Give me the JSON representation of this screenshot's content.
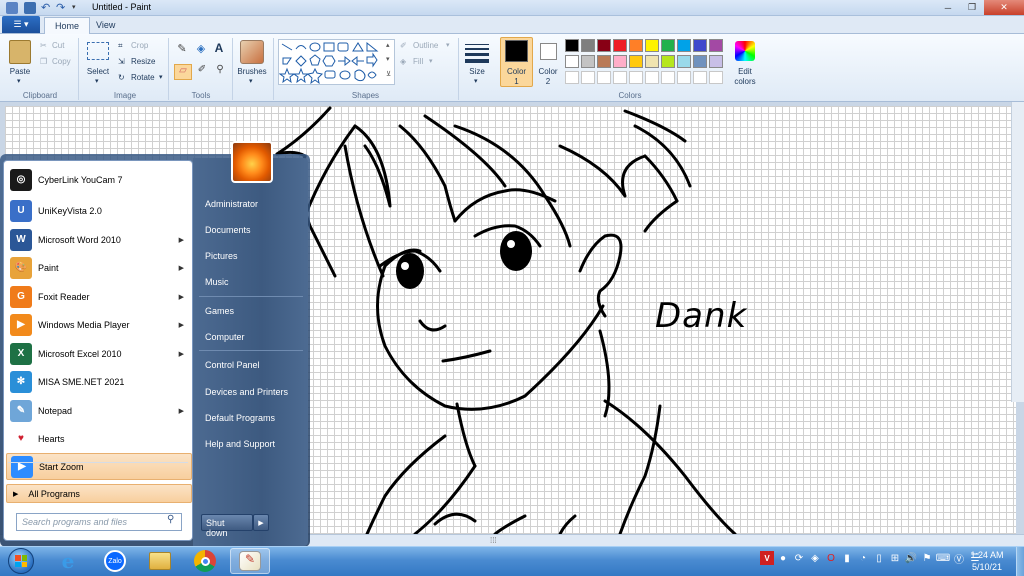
{
  "window": {
    "title": "Untitled - Paint"
  },
  "tabs": {
    "file": "",
    "home": "Home",
    "view": "View"
  },
  "clipboard": {
    "paste": "Paste",
    "cut": "Cut",
    "copy": "Copy",
    "group": "Clipboard"
  },
  "image": {
    "select": "Select",
    "crop": "Crop",
    "resize": "Resize",
    "rotate": "Rotate",
    "group": "Image"
  },
  "tools": {
    "group": "Tools"
  },
  "brushes": {
    "label": "Brushes"
  },
  "shapes": {
    "outline": "Outline",
    "fill": "Fill",
    "group": "Shapes"
  },
  "size": {
    "label": "Size"
  },
  "colors": {
    "color1_line1": "Color",
    "color1_line2": "1",
    "color2_line1": "Color",
    "color2_line2": "2",
    "edit_line1": "Edit",
    "edit_line2": "colors",
    "group": "Colors",
    "palette_row1": [
      "#000000",
      "#7f7f7f",
      "#880015",
      "#ed1c24",
      "#ff7f27",
      "#fff200",
      "#22b14c",
      "#00a2e8",
      "#3f48cc",
      "#a349a4"
    ],
    "palette_row2": [
      "#ffffff",
      "#c3c3c3",
      "#b97a57",
      "#ffaec9",
      "#ffc90e",
      "#efe4b0",
      "#b5e61d",
      "#99d9ea",
      "#7092be",
      "#c8bfe7"
    ],
    "palette_row3": [
      "#ffffff",
      "#ffffff",
      "#ffffff",
      "#ffffff",
      "#ffffff",
      "#ffffff",
      "#ffffff",
      "#ffffff",
      "#ffffff",
      "#ffffff"
    ]
  },
  "canvas": {
    "signature": "Dank"
  },
  "start_menu": {
    "left_items": [
      {
        "label": "CyberLink YouCam 7",
        "icon": "youcam-icon",
        "color": "#1a1a1a",
        "glyph": "◎",
        "arrow": ""
      },
      {
        "label": "UniKeyVista 2.0",
        "icon": "unikey-icon",
        "color": "#3a6fc8",
        "glyph": "U",
        "arrow": ""
      },
      {
        "label": "Microsoft Word 2010",
        "icon": "word-icon",
        "color": "#2b5797",
        "glyph": "W",
        "arrow": "▶"
      },
      {
        "label": "Paint",
        "icon": "paint-icon",
        "color": "#e8a33a",
        "glyph": "🎨",
        "arrow": "▶"
      },
      {
        "label": "Foxit Reader",
        "icon": "foxit-icon",
        "color": "#f07b1a",
        "glyph": "G",
        "arrow": "▶"
      },
      {
        "label": "Windows Media Player",
        "icon": "media-player-icon",
        "color": "#f28a1b",
        "glyph": "▶",
        "arrow": "▶"
      },
      {
        "label": "Microsoft Excel 2010",
        "icon": "excel-icon",
        "color": "#1e7145",
        "glyph": "X",
        "arrow": "▶"
      },
      {
        "label": "MISA SME.NET 2021",
        "icon": "misa-icon",
        "color": "#2a8fd8",
        "glyph": "✻",
        "arrow": ""
      },
      {
        "label": "Notepad",
        "icon": "notepad-icon",
        "color": "#6fa6d8",
        "glyph": "✎",
        "arrow": "▶"
      },
      {
        "label": "Hearts",
        "icon": "hearts-icon",
        "color": "#ffffff",
        "glyph": "♥",
        "arrow": ""
      },
      {
        "label": "Start Zoom",
        "icon": "zoom-icon",
        "color": "#2d8cff",
        "glyph": "▶",
        "arrow": ""
      }
    ],
    "all_programs": "All Programs",
    "search_placeholder": "Search programs and files",
    "right_items": [
      "Administrator",
      "Documents",
      "Pictures",
      "Music",
      "Games",
      "Computer",
      "Control Panel",
      "Devices and Printers",
      "Default Programs",
      "Help and Support"
    ],
    "shutdown": "Shut down"
  },
  "taskbar": {
    "time": "1:24 AM",
    "date": "5/10/21",
    "apps": [
      "internet-explorer-icon",
      "zalo-icon",
      "file-explorer-icon",
      "chrome-icon",
      "paint-icon"
    ],
    "zalo_label": "Zalo"
  }
}
